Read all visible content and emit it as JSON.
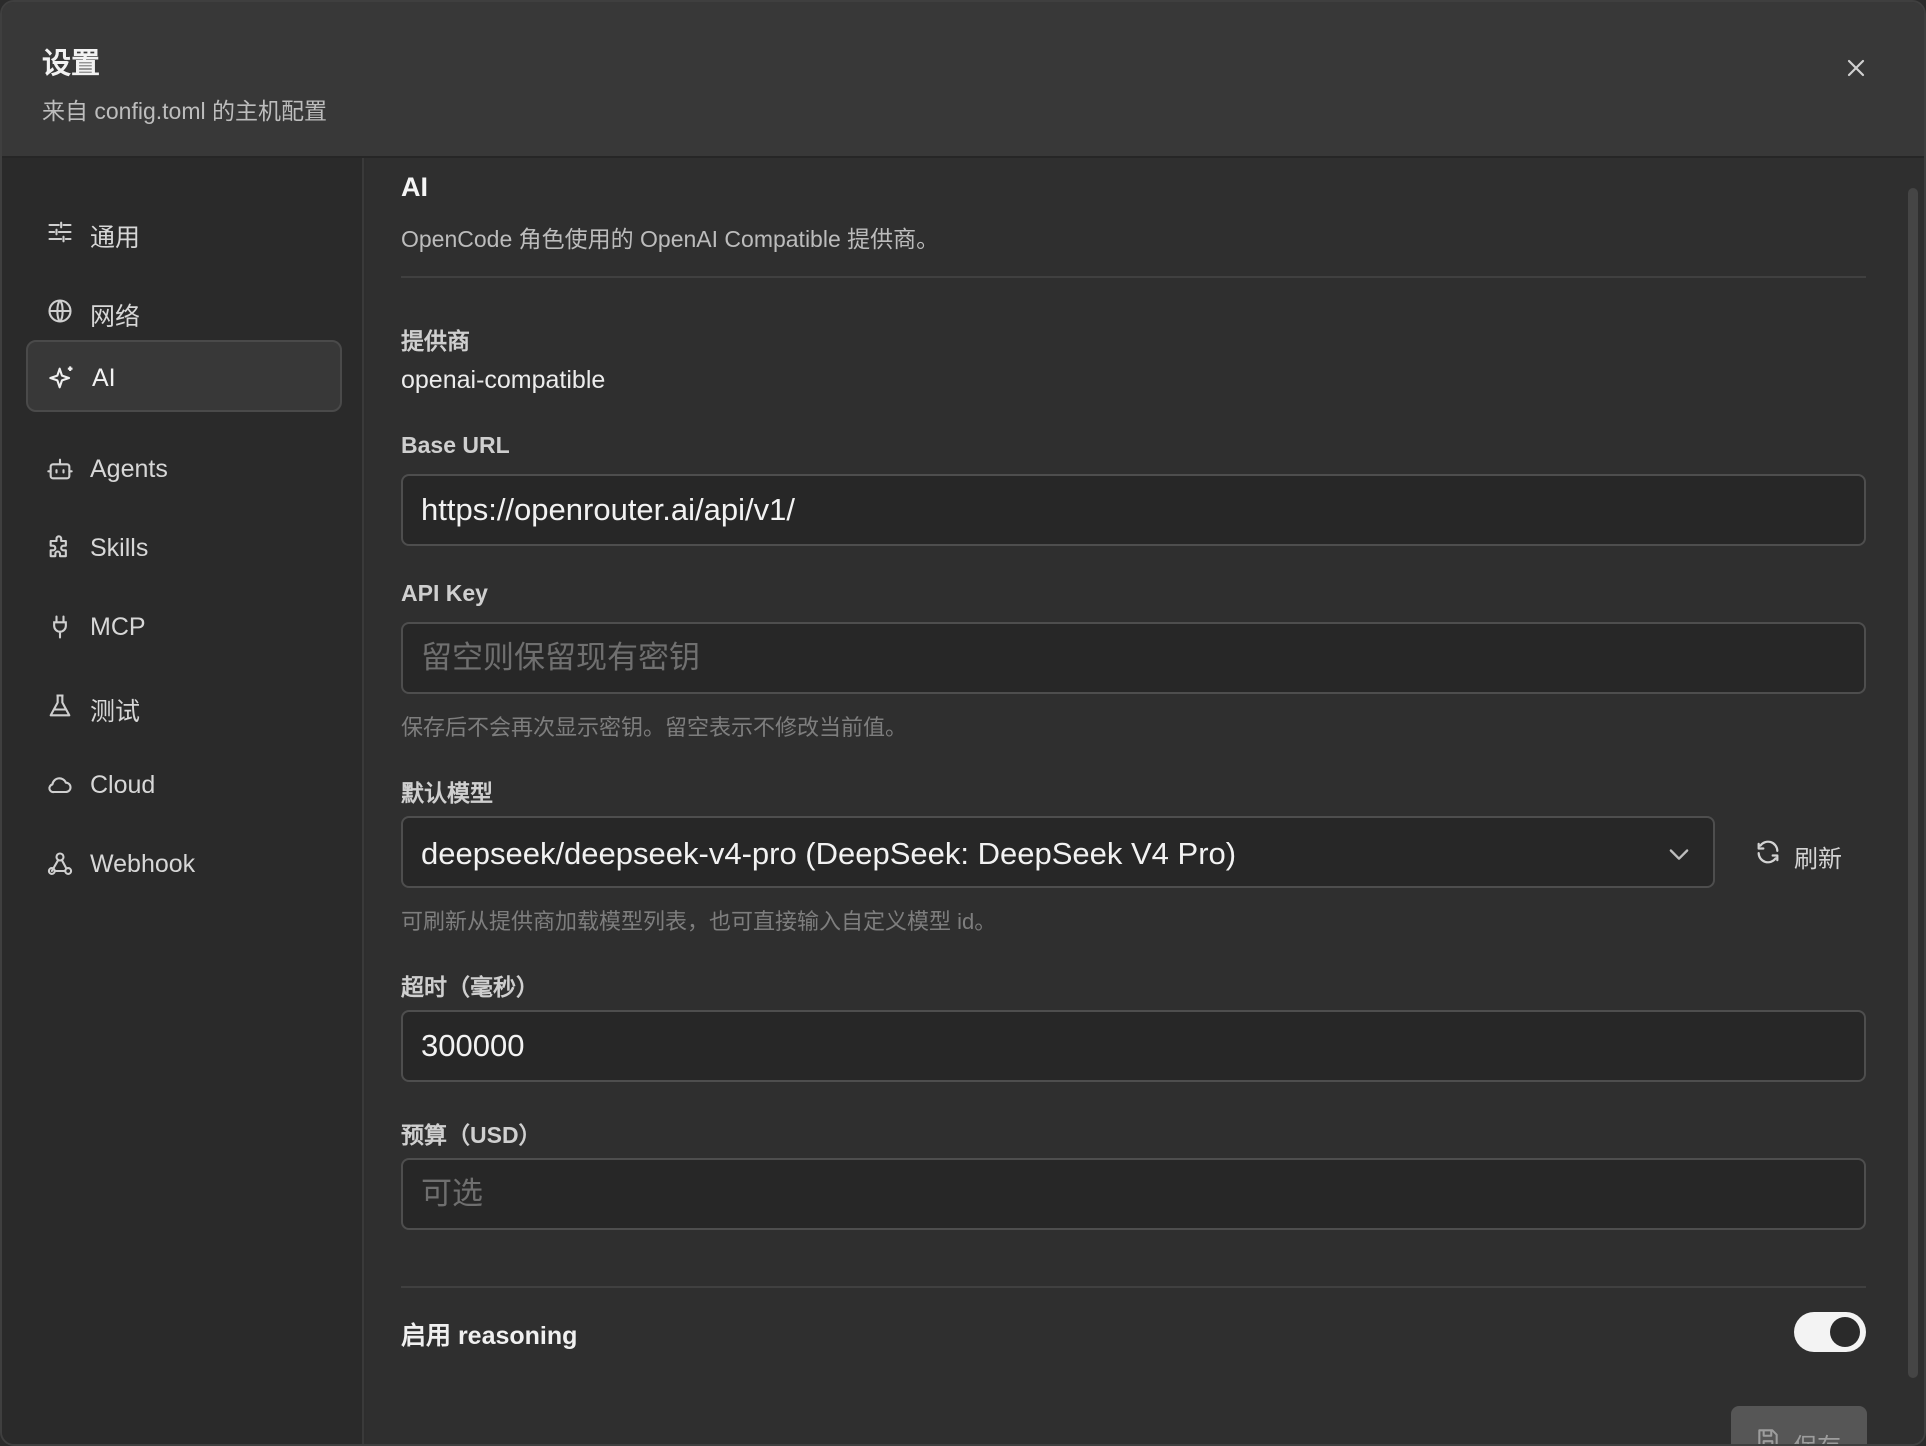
{
  "header": {
    "title": "设置",
    "subtitle": "来自 config.toml 的主机配置"
  },
  "sidebar": {
    "items": [
      {
        "label": "通用",
        "icon": "sliders-icon"
      },
      {
        "label": "网络",
        "icon": "globe-icon"
      },
      {
        "label": "AI",
        "icon": "sparkles-icon",
        "active": true
      },
      {
        "label": "Agents",
        "icon": "bot-icon"
      },
      {
        "label": "Skills",
        "icon": "puzzle-icon"
      },
      {
        "label": "MCP",
        "icon": "plug-icon"
      },
      {
        "label": "测试",
        "icon": "flask-icon"
      },
      {
        "label": "Cloud",
        "icon": "cloud-icon"
      },
      {
        "label": "Webhook",
        "icon": "webhook-icon"
      }
    ]
  },
  "main": {
    "title": "AI",
    "description": "OpenCode 角色使用的 OpenAI Compatible 提供商。",
    "provider": {
      "label": "提供商",
      "value": "openai-compatible"
    },
    "base_url": {
      "label": "Base URL",
      "value": "https://openrouter.ai/api/v1/"
    },
    "api_key": {
      "label": "API Key",
      "placeholder": "留空则保留现有密钥",
      "hint": "保存后不会再次显示密钥。留空表示不修改当前值。"
    },
    "default_model": {
      "label": "默认模型",
      "value": "deepseek/deepseek-v4-pro (DeepSeek: DeepSeek V4 Pro)",
      "refresh_label": "刷新",
      "hint": "可刷新从提供商加载模型列表，也可直接输入自定义模型 id。"
    },
    "timeout": {
      "label": "超时（毫秒）",
      "value": "300000"
    },
    "budget": {
      "label": "预算（USD）",
      "placeholder": "可选"
    },
    "reasoning": {
      "label": "启用 reasoning",
      "enabled": true
    },
    "save_label": "保存"
  },
  "colors": {
    "background": "#2e2e2e",
    "header": "#383838",
    "sidebar": "#2a2a2a",
    "input_bg": "#272727",
    "border": "#4e4e4e",
    "toggle_on": "#f3f3f3"
  }
}
